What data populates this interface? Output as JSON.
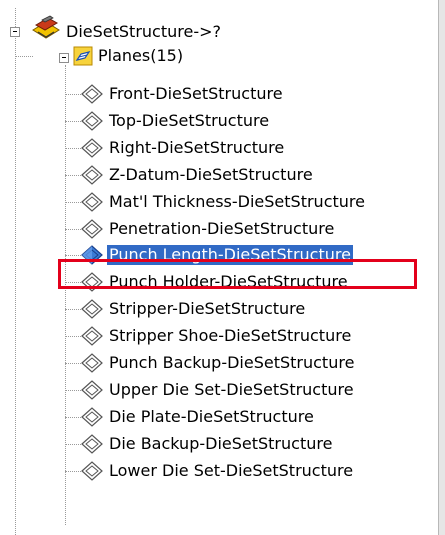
{
  "tree": {
    "root": {
      "label": "DieSetStructure->?",
      "icon": "die-set-structure-icon"
    },
    "folder": {
      "label": "Planes(15)",
      "icon": "planes-folder-icon"
    },
    "planes": [
      "Front-DieSetStructure",
      "Top-DieSetStructure",
      "Right-DieSetStructure",
      "Z-Datum-DieSetStructure",
      "Mat'l Thickness-DieSetStructure",
      "Penetration-DieSetStructure",
      "Punch Length-DieSetStructure",
      "Punch Holder-DieSetStructure",
      "Stripper-DieSetStructure",
      "Stripper Shoe-DieSetStructure",
      "Punch Backup-DieSetStructure",
      "Upper Die Set-DieSetStructure",
      "Die Plate-DieSetStructure",
      "Die Backup-DieSetStructure",
      "Lower Die Set-DieSetStructure"
    ],
    "selected_index": 6
  },
  "colors": {
    "selection": "#316ac5",
    "highlight_border": "#e3001b"
  }
}
